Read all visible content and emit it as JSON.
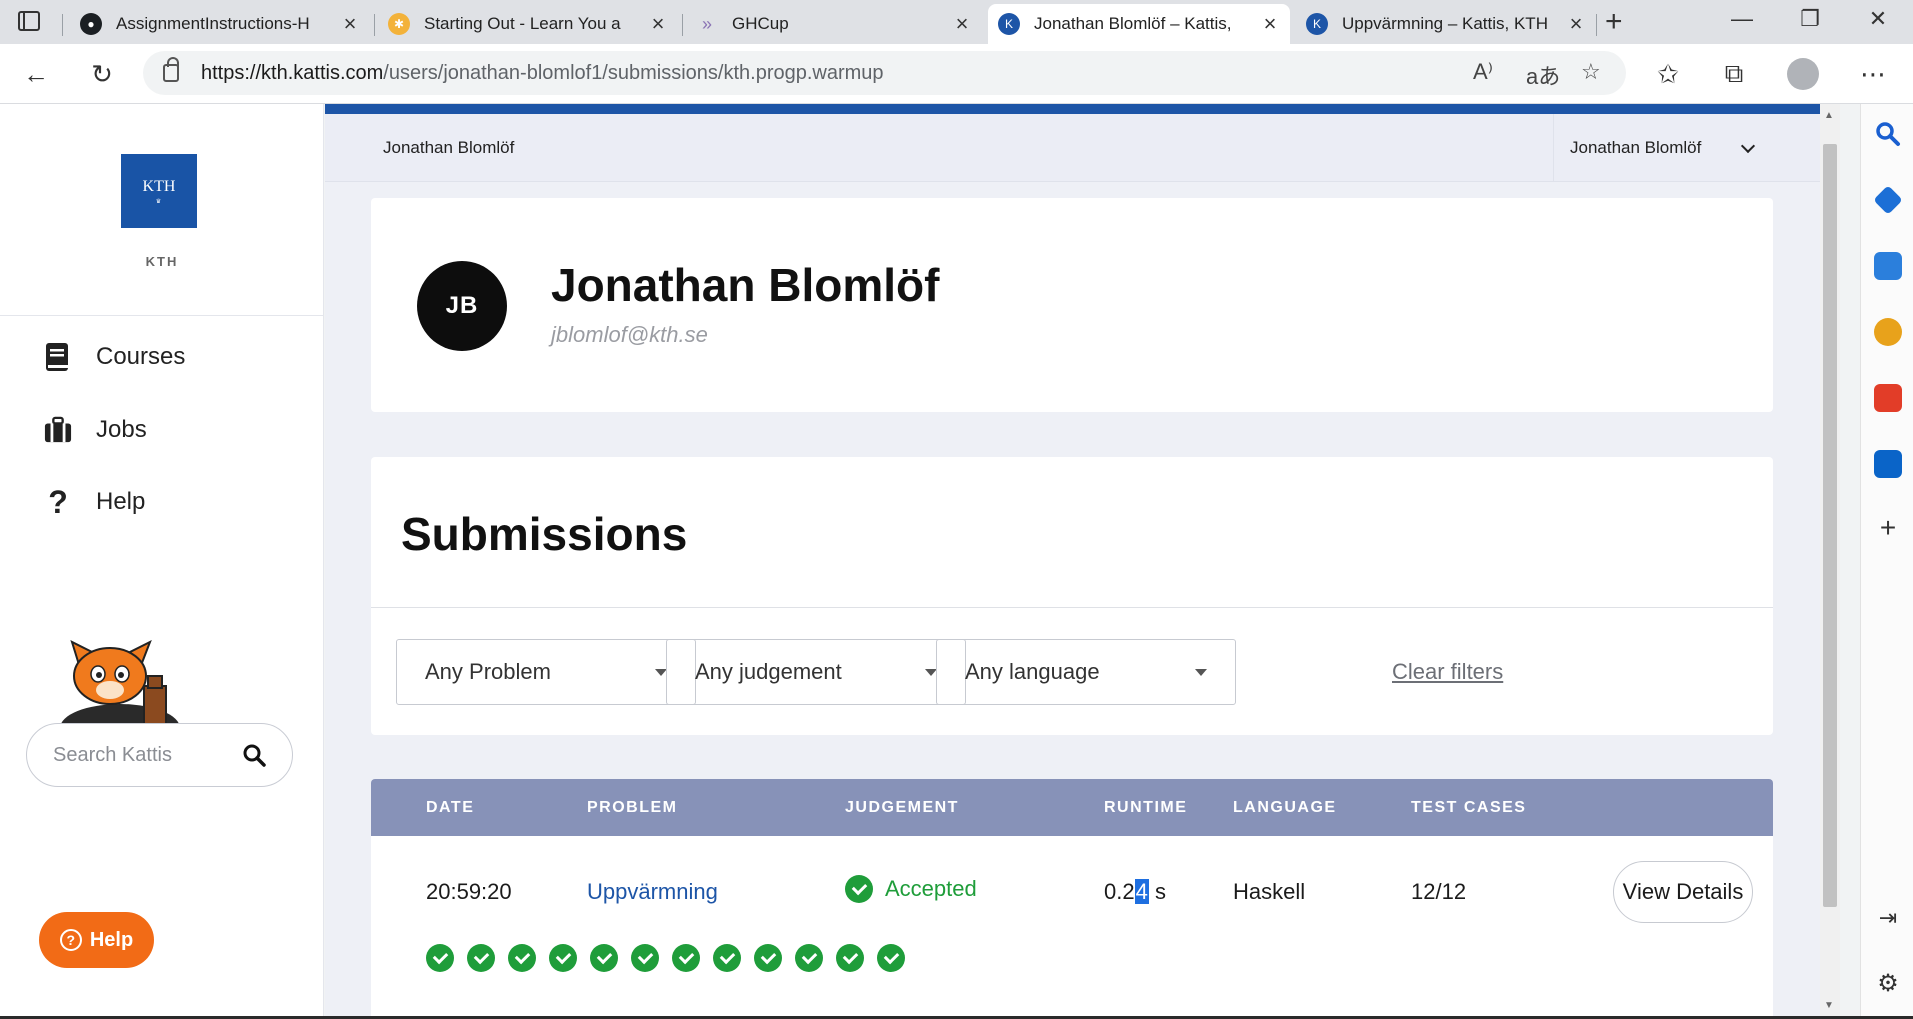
{
  "browser": {
    "tabs": [
      {
        "title": "AssignmentInstructions-H",
        "active": false
      },
      {
        "title": "Starting Out - Learn You a",
        "active": false
      },
      {
        "title": "GHCup",
        "active": false
      },
      {
        "title": "Jonathan Blomlöf – Kattis,",
        "active": true
      },
      {
        "title": "Uppvärmning – Kattis, KTH",
        "active": false
      }
    ],
    "url_host": "https://kth.kattis.com",
    "url_path": "/users/jonathan-blomlof1/submissions/kth.progp.warmup"
  },
  "sidebar": {
    "org_label": "KTH",
    "logo_text": "KTH",
    "nav": [
      {
        "label": "Courses"
      },
      {
        "label": "Jobs"
      },
      {
        "label": "Help"
      }
    ],
    "search_placeholder": "Search Kattis",
    "help_button": "Help"
  },
  "header": {
    "user_name": "Jonathan Blomlöf",
    "user_menu": "Jonathan Blomlöf"
  },
  "profile": {
    "initials": "JB",
    "name": "Jonathan Blomlöf",
    "email": "jblomlof@kth.se"
  },
  "submissions": {
    "title": "Submissions",
    "filters": {
      "problem": "Any Problem",
      "judgement": "Any judgement",
      "language": "Any language",
      "clear": "Clear filters"
    },
    "columns": [
      "DATE",
      "PROBLEM",
      "JUDGEMENT",
      "RUNTIME",
      "LANGUAGE",
      "TEST CASES"
    ],
    "rows": [
      {
        "date": "20:59:20",
        "problem": "Uppvärmning",
        "judgement": "Accepted",
        "runtime_before": "0.2",
        "runtime_selected": "4",
        "runtime_after": " s",
        "language": "Haskell",
        "test_cases": "12/12",
        "action": "View Details",
        "passed_tests": 12
      }
    ]
  },
  "colors": {
    "brand_blue": "#1d55a7",
    "accepted_green": "#1f9d3a",
    "table_header": "#8792b8",
    "help_orange": "#f26b16"
  }
}
